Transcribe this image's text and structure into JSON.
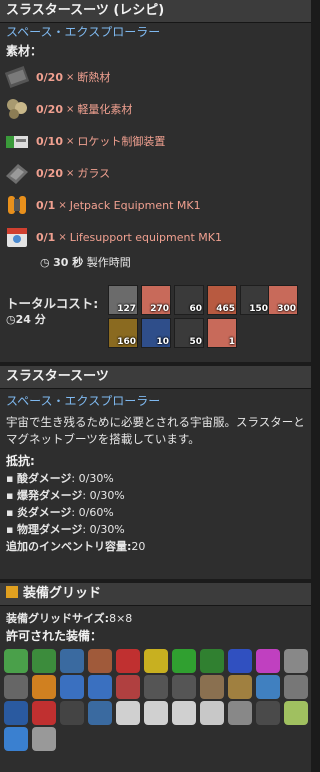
{
  "recipe": {
    "title": "スラスタースーツ (レシピ)",
    "subtitle": "スペース・エクスプローラー",
    "ingredients_label": "素材：",
    "ingredients": [
      {
        "qty": "0/20",
        "x": "×",
        "name": "断熱材",
        "icon": "insulation-icon"
      },
      {
        "qty": "0/20",
        "x": "×",
        "name": "軽量化素材",
        "icon": "lightweight-material-icon"
      },
      {
        "qty": "0/10",
        "x": "×",
        "name": "ロケット制御装置",
        "icon": "rocket-control-unit-icon"
      },
      {
        "qty": "0/20",
        "x": "×",
        "name": "ガラス",
        "icon": "glass-icon"
      },
      {
        "qty": "0/1",
        "x": "×",
        "name": "Jetpack Equipment MK1",
        "icon": "jetpack-icon"
      },
      {
        "qty": "0/1",
        "x": "×",
        "name": "Lifesupport equipment MK1",
        "icon": "lifesupport-icon"
      }
    ],
    "time_value": "30 秒",
    "time_label": "製作時間",
    "total_cost_label": "トータルコスト:",
    "total_time": "24 分",
    "cost_items": [
      "127",
      "270",
      "60",
      "465",
      "150",
      "300",
      "160",
      "10",
      "50",
      "1"
    ]
  },
  "item": {
    "title": "スラスタースーツ",
    "subtitle": "スペース・エクスプローラー",
    "description": "宇宙で生き残るために必要とされる宇宙服。スラスターとマグネットブーツを搭載しています。",
    "resist_label": "抵抗:",
    "resists": [
      {
        "name": "酸ダメージ",
        "value": "0/30%"
      },
      {
        "name": "爆発ダメージ",
        "value": "0/30%"
      },
      {
        "name": "炎ダメージ",
        "value": "0/60%"
      },
      {
        "name": "物理ダメージ",
        "value": "0/30%"
      }
    ],
    "inventory_label": "追加のインベントリ容量:",
    "inventory_value": "20"
  },
  "equip": {
    "title": "装備グリッド",
    "grid_size_label": "装備グリッドサイズ:",
    "grid_size_value": "8×8",
    "allowed_label": "許可された装備："
  },
  "colors": {
    "accent_blue": "#7fb9f0",
    "missing_red": "#f0a090"
  }
}
